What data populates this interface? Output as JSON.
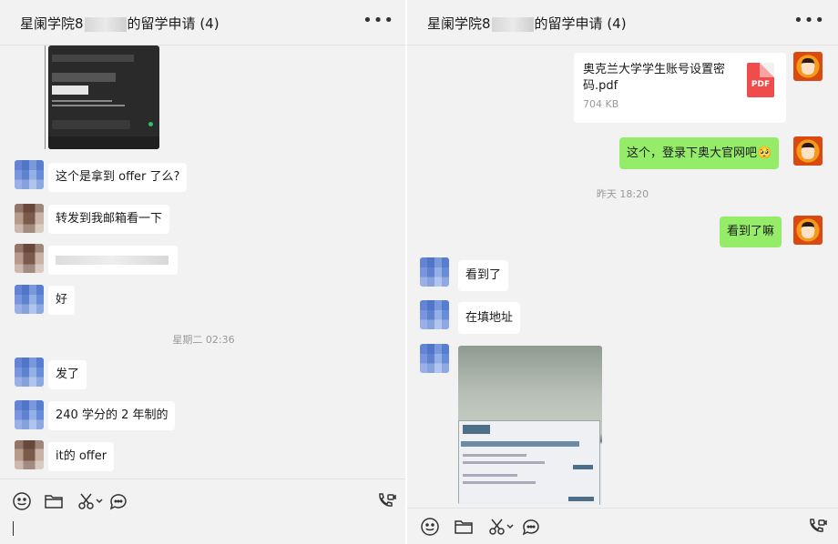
{
  "left": {
    "header": {
      "title_pre": "星阑学院8",
      "title_post": "的留学申请 (4)",
      "more": "•••"
    },
    "messages": [
      {
        "text": "这个是拿到 offer 了么?"
      },
      {
        "text": "转发到我邮箱看一下"
      },
      {
        "text": "好"
      },
      {
        "text": "发了"
      },
      {
        "text": "240 学分的 2 年制的"
      },
      {
        "text": "it的 offer"
      }
    ],
    "timestamp": "星期二 02:36"
  },
  "right": {
    "header": {
      "title_pre": "星阑学院8",
      "title_post": "的留学申请 (4)",
      "more": "•••"
    },
    "file": {
      "name": "奥克兰大学学生账号设置密码.pdf",
      "size": "704 KB",
      "type": "PDF"
    },
    "messages": [
      {
        "text": "这个，登录下奥大官网吧🥺"
      },
      {
        "text": "看到了嘛"
      },
      {
        "text": "看到了"
      },
      {
        "text": "在填地址"
      }
    ],
    "timestamp": "昨天 18:20"
  },
  "colors": {
    "me_bubble": "#95ec69",
    "bg": "#f2f2f3",
    "pdf": "#f04c4c"
  },
  "icons": [
    "emoji-icon",
    "folder-icon",
    "scissors-icon",
    "chat-icon",
    "video-call-icon"
  ]
}
